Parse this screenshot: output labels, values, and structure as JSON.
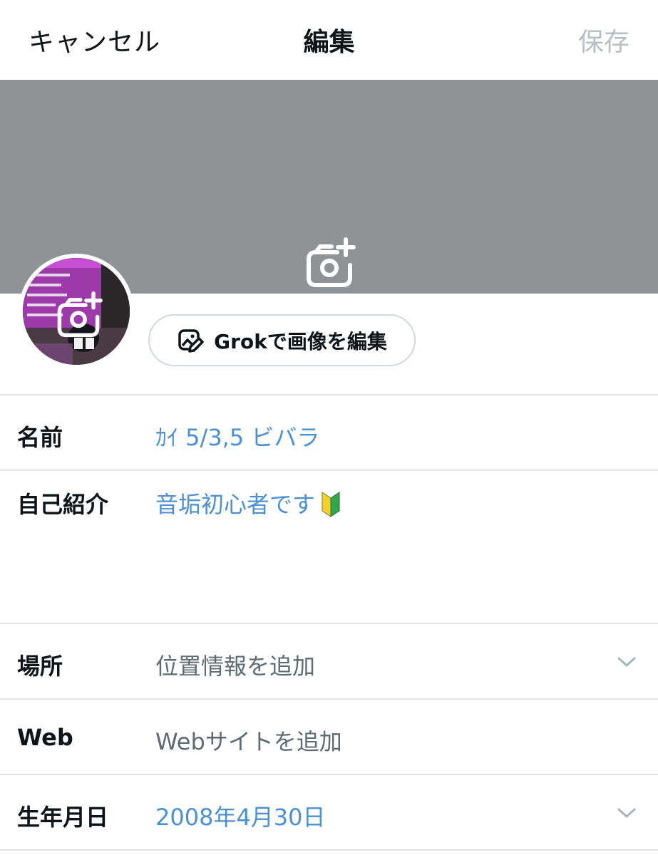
{
  "header": {
    "cancel_label": "キャンセル",
    "title": "編集",
    "save_label": "保存"
  },
  "banner": {
    "color": "#8f9396",
    "icon": "camera-plus-icon"
  },
  "avatar": {
    "icon": "camera-plus-icon"
  },
  "grok_button": {
    "icon": "image-edit-icon",
    "label": "Grokで画像を編集"
  },
  "fields": {
    "name": {
      "label": "名前",
      "value": "ｶｲ 5/3,5 ビバラ"
    },
    "bio": {
      "label": "自己紹介",
      "value": "音垢初心者です",
      "badge": "beginner-mark-icon"
    },
    "location": {
      "label": "場所",
      "placeholder": "位置情報を追加",
      "icon": "chevron-down-icon"
    },
    "web": {
      "label": "Web",
      "placeholder": "Webサイトを追加"
    },
    "birthday": {
      "label": "生年月日",
      "value": "2008年4月30日",
      "icon": "chevron-down-icon"
    }
  },
  "colors": {
    "link_blue": "#4a90d6",
    "placeholder_gray": "#5f6a73",
    "disabled_gray": "#b9bec2"
  }
}
